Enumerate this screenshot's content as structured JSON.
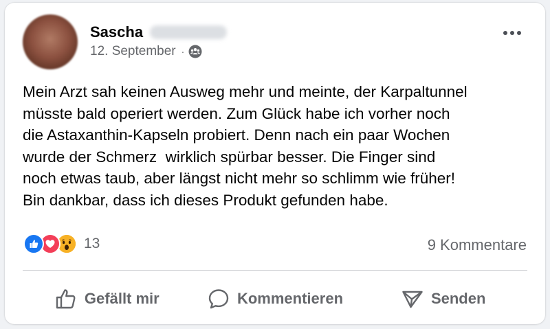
{
  "post": {
    "author_first_name": "Sascha",
    "date": "12. September",
    "separator": "·",
    "audience_icon": "friends-icon",
    "text": "Mein Arzt sah keinen Ausweg mehr und meinte, der Karpaltunnel\nmüsste bald operiert werden. Zum Glück habe ich vorher noch\ndie Astaxanthin-Kapseln probiert. Denn nach ein paar Wochen\nwurde der Schmerz  wirklich spürbar besser. Die Finger sind\nnoch etwas taub, aber längst nicht mehr so schlimm wie früher!\nBin dankbar, dass ich dieses Produkt gefunden habe."
  },
  "reactions": {
    "types": [
      "like",
      "love",
      "wow"
    ],
    "count": "13"
  },
  "comments": {
    "label": "9 Kommentare"
  },
  "actions": {
    "like_label": "Gefällt mir",
    "comment_label": "Kommentieren",
    "share_label": "Senden"
  },
  "colors": {
    "like": "#1877f2",
    "love": "#f33e58",
    "wow": "#f7b125",
    "secondary_text": "#65676b"
  }
}
